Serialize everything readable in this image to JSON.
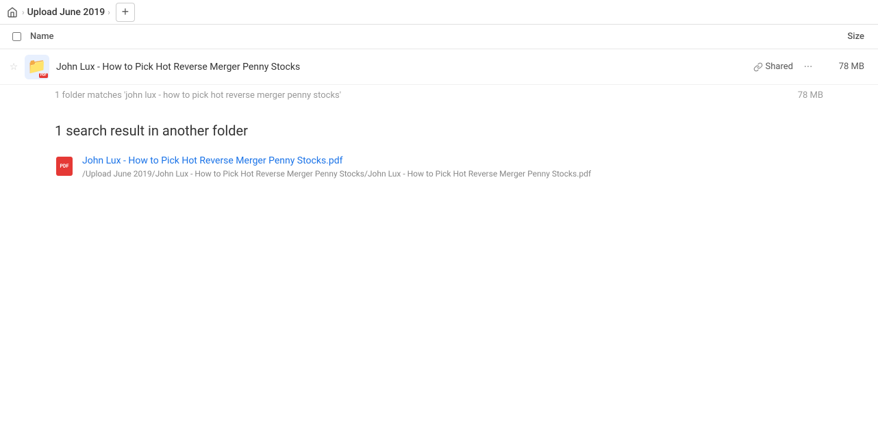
{
  "topbar": {
    "home_icon": "🏠",
    "sep1": "›",
    "breadcrumb": "Upload June 2019",
    "add_button_label": "+"
  },
  "columns": {
    "name_label": "Name",
    "size_label": "Size"
  },
  "folder_row": {
    "star_icon": "☆",
    "folder_name": "John Lux - How to Pick Hot Reverse Merger Penny Stocks",
    "shared_label": "Shared",
    "size": "78 MB",
    "more_icon": "…"
  },
  "match_count": {
    "text": "1 folder matches 'john lux - how to pick hot reverse merger penny stocks'",
    "size": "78 MB"
  },
  "section": {
    "heading": "1 search result in another folder"
  },
  "results": [
    {
      "filename": "John Lux - How to Pick Hot Reverse Merger Penny Stocks.pdf",
      "path": "/Upload June 2019/John Lux - How to Pick Hot Reverse Merger Penny Stocks/John Lux - How to Pick Hot Reverse Merger Penny Stocks.pdf"
    }
  ]
}
